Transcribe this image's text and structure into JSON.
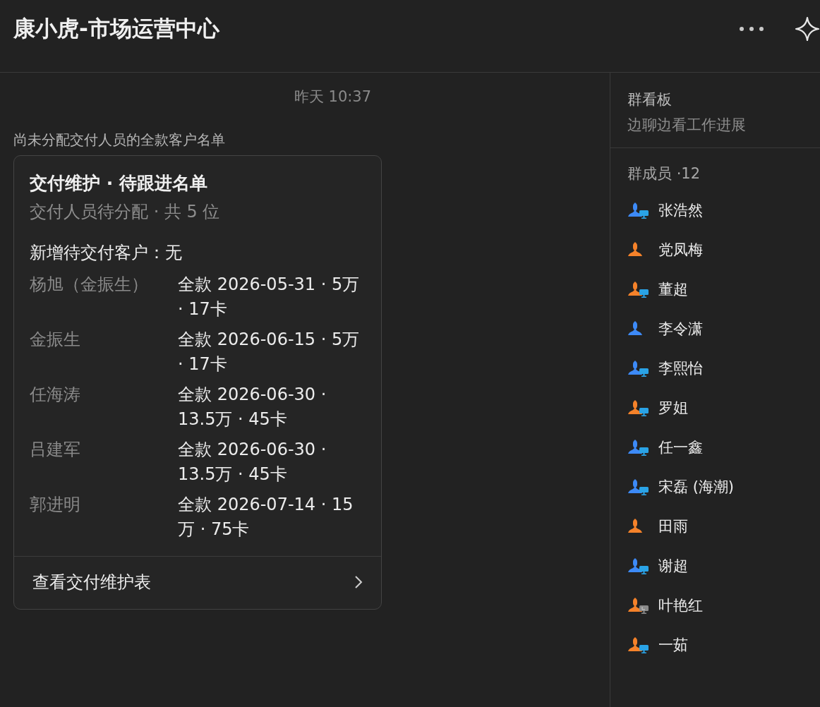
{
  "header": {
    "title": "康小虎-市场运营中心"
  },
  "chat": {
    "timestamp": "昨天 10:37",
    "message": "尚未分配交付人员的全款客户名单",
    "card": {
      "title": "交付维护 · 待跟进名单",
      "subtitle": "交付人员待分配 · 共 5 位",
      "summary": "新增待交付客户：无",
      "rows": [
        {
          "name": "杨旭（金振生）",
          "detail": "全款 2026-05-31 · 5万 · 17卡"
        },
        {
          "name": "金振生",
          "detail": "全款 2026-06-15 · 5万 · 17卡"
        },
        {
          "name": "任海涛",
          "detail": "全款 2026-06-30 · 13.5万 · 45卡"
        },
        {
          "name": "吕建军",
          "detail": "全款 2026-06-30 · 13.5万 · 45卡"
        },
        {
          "name": "郭进明",
          "detail": "全款 2026-07-14 · 15万 · 75卡"
        }
      ],
      "link": "查看交付维护表"
    }
  },
  "sidebar": {
    "board_title": "群看板",
    "board_subtitle": "边聊边看工作进展",
    "members_title": "群成员 ·12",
    "members": [
      {
        "name": "张浩然",
        "color": "#3d8af7",
        "kind": "desktop"
      },
      {
        "name": "党凤梅",
        "color": "#f5822a",
        "kind": "none"
      },
      {
        "name": "董超",
        "color": "#f5822a",
        "kind": "desktop"
      },
      {
        "name": "李令潇",
        "color": "#3d8af7",
        "kind": "none"
      },
      {
        "name": "李熙怡",
        "color": "#3d8af7",
        "kind": "desktop"
      },
      {
        "name": "罗姐",
        "color": "#f5822a",
        "kind": "desktop"
      },
      {
        "name": "任一鑫",
        "color": "#3d8af7",
        "kind": "desktop"
      },
      {
        "name": "宋磊 (海潮)",
        "color": "#3d8af7",
        "kind": "desktop"
      },
      {
        "name": "田雨",
        "color": "#f5822a",
        "kind": "none"
      },
      {
        "name": "谢超",
        "color": "#3d8af7",
        "kind": "desktop"
      },
      {
        "name": "叶艳红",
        "color": "#f5822a",
        "kind": "desktop_idle"
      },
      {
        "name": "一茹",
        "color": "#f5822a",
        "kind": "desktop"
      }
    ]
  }
}
